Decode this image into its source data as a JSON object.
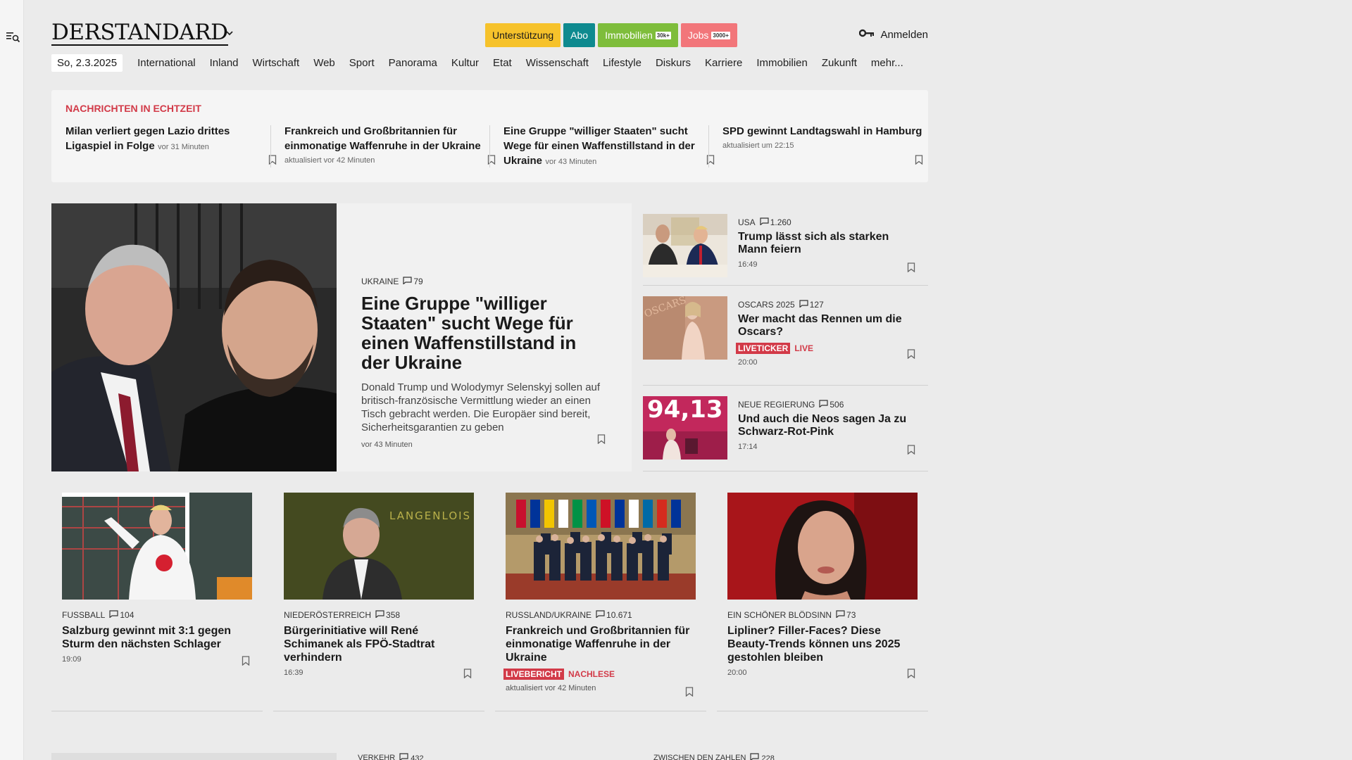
{
  "sidebar": {
    "menu_icon": "search-menu-icon"
  },
  "header": {
    "logo": "DERSTANDARD",
    "buttons": [
      {
        "label": "Unterstützung",
        "color": "#f6c22b"
      },
      {
        "label": "Abo",
        "color": "#0e8a8f"
      },
      {
        "label": "Immobilien",
        "tag": "30k+",
        "color": "#7ebd3b"
      },
      {
        "label": "Jobs",
        "tag": "3000+",
        "color": "#f2767a"
      }
    ],
    "login_label": "Anmelden"
  },
  "nav": {
    "date": "So, 2.3.2025",
    "items": [
      "International",
      "Inland",
      "Wirtschaft",
      "Web",
      "Sport",
      "Panorama",
      "Kultur",
      "Etat",
      "Wissenschaft",
      "Lifestyle",
      "Diskurs",
      "Karriere",
      "Immobilien",
      "Zukunft",
      "mehr..."
    ]
  },
  "ticker": {
    "title": "NACHRICHTEN IN ECHTZEIT",
    "items": [
      {
        "title": "Milan verliert gegen Lazio drittes Ligaspiel in Folge",
        "meta": "vor 31 Minuten"
      },
      {
        "title": "Frankreich und Großbritannien für einmonatige Waffenruhe in der Ukraine",
        "meta": "aktualisiert vor 42 Minuten"
      },
      {
        "title": "Eine Gruppe \"williger Staaten\" sucht Wege für einen Waffenstillstand in der Ukraine",
        "meta": "vor 43 Minuten"
      },
      {
        "title": "SPD gewinnt Landtagswahl in Hamburg",
        "meta": "aktualisiert um 22:15"
      }
    ]
  },
  "hero": {
    "kicker": "UKRAINE",
    "comments": "79",
    "title": "Eine Gruppe \"williger Staaten\" sucht Wege für einen Waffenstillstand in der Ukraine",
    "desc": "Donald Trump und Wolodymyr Selenskyj sollen auf britisch-französische Vermittlung wieder an einen Tisch gebracht werden. Die Europäer sind bereit, Sicherheitsgarantien zu geben",
    "time": "vor 43 Minuten"
  },
  "side": [
    {
      "kicker": "USA",
      "comments": "1.260",
      "title": "Trump lässt sich als starken Mann feiern",
      "time": "16:49"
    },
    {
      "kicker": "OSCARS 2025",
      "comments": "127",
      "title": "Wer macht das Rennen um die Oscars?",
      "badge": "LIVETICKER",
      "badge_word": "LIVE",
      "time": "20:00"
    },
    {
      "kicker": "NEUE REGIERUNG",
      "comments": "506",
      "title": "Und auch die Neos sagen Ja zu Schwarz-Rot-Pink",
      "time": "17:14",
      "thumb_text": "94,13"
    }
  ],
  "grid": [
    {
      "kicker": "FUSSBALL",
      "comments": "104",
      "title": "Salzburg gewinnt mit 3:1 gegen Sturm den nächsten Schlager",
      "time": "19:09"
    },
    {
      "kicker": "NIEDERÖSTERREICH",
      "comments": "358",
      "title": "Bürgerinitiative will René Schimanek als FPÖ-Stadtrat verhindern",
      "time": "16:39",
      "img_text": "LANGENLOIS"
    },
    {
      "kicker": "RUSSLAND/UKRAINE",
      "comments": "10.671",
      "title": "Frankreich und Großbritannien für einmonatige Waffenruhe in der Ukraine",
      "badge": "LIVEBERICHT",
      "badge_word": "NACHLESE",
      "time": "aktualisiert vor 42 Minuten"
    },
    {
      "kicker": "EIN SCHÖNER BLÖDSINN",
      "comments": "73",
      "title": "Lipliner? Filler-Faces? Diese Beauty-Trends können uns 2025 gestohlen bleiben",
      "time": "20:00"
    }
  ],
  "bottom": [
    {
      "kicker": "VERKEHR",
      "comments": "432"
    },
    {
      "kicker": "ZWISCHEN DEN ZAHLEN",
      "comments": "228"
    }
  ]
}
